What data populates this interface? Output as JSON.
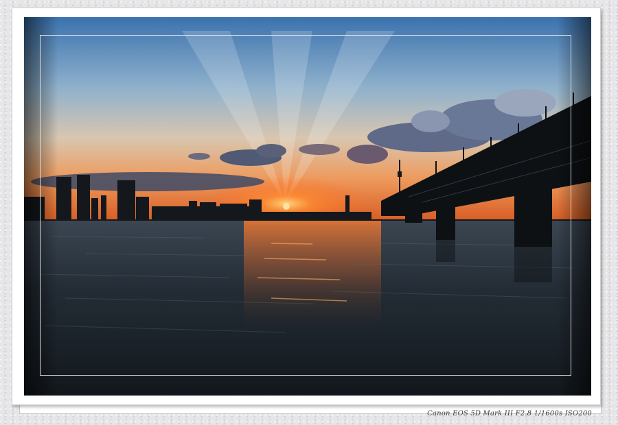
{
  "photo": {
    "caption": "Canon EOS 5D Mark III F2.8 1/1600s ISO200",
    "scene": "sunset-river-bridge",
    "colors": {
      "sky_top": "#3f78b4",
      "sky_mid": "#a9c0cf",
      "horizon_glow": "#f2732a",
      "sun": "#ffb04a",
      "water": "#1f2a33",
      "silhouette": "#14181c",
      "mat": "#ffffff",
      "frame": "#101418"
    }
  }
}
